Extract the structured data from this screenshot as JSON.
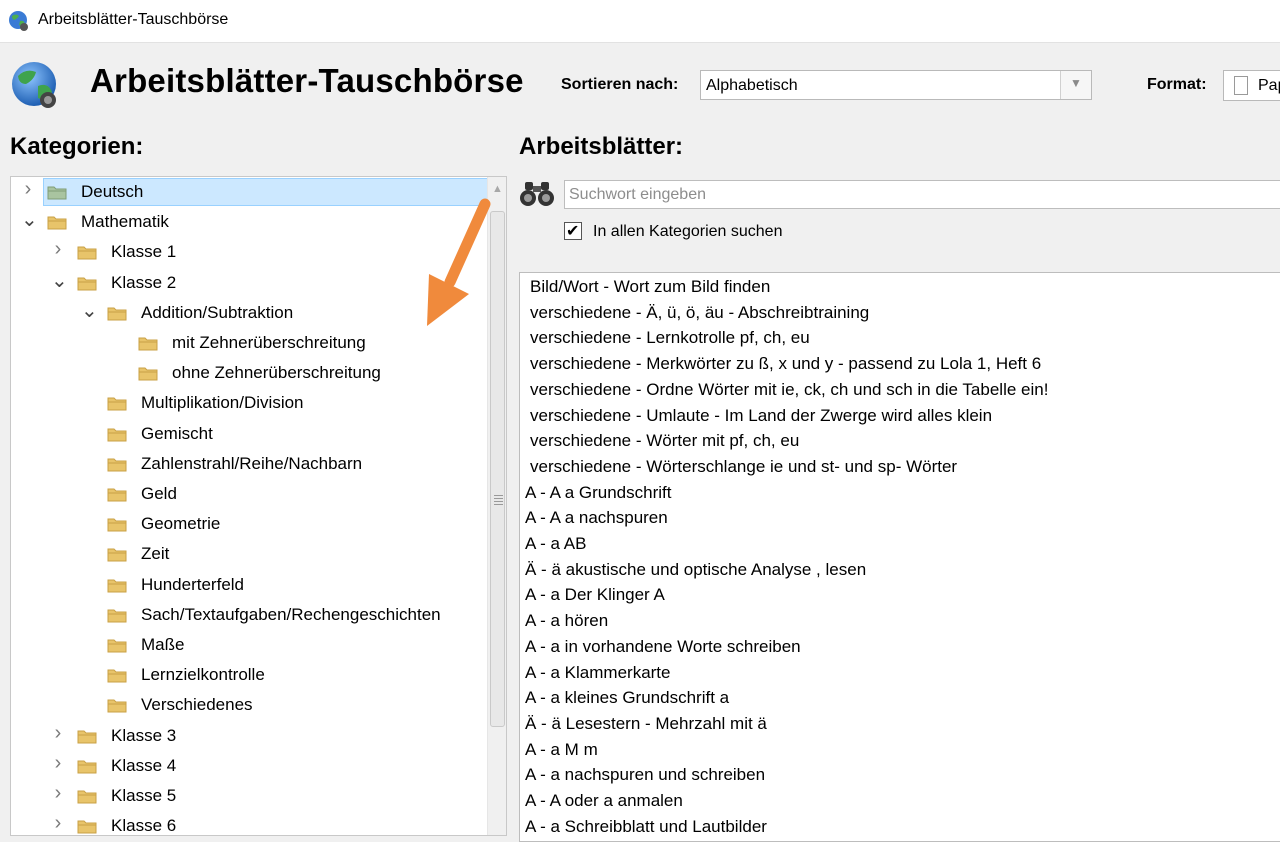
{
  "window": {
    "title": "Arbeitsblätter-Tauschbörse"
  },
  "header": {
    "app_title": "Arbeitsblätter-Tauschbörse",
    "sort_label": "Sortieren nach:",
    "sort_value": "Alphabetisch",
    "format_label": "Format:",
    "format_value": "Papier"
  },
  "categories": {
    "heading": "Kategorien:",
    "tree": [
      {
        "label": "Deutsch",
        "level": 0,
        "expander": "collapsed",
        "selected": true,
        "folder_color": "green"
      },
      {
        "label": "Mathematik",
        "level": 0,
        "expander": "expanded"
      },
      {
        "label": "Klasse 1",
        "level": 1,
        "expander": "collapsed"
      },
      {
        "label": "Klasse 2",
        "level": 1,
        "expander": "expanded"
      },
      {
        "label": "Addition/Subtraktion",
        "level": 2,
        "expander": "expanded"
      },
      {
        "label": "mit Zehnerüberschreitung",
        "level": 3,
        "expander": "none"
      },
      {
        "label": "ohne Zehnerüberschreitung",
        "level": 3,
        "expander": "none"
      },
      {
        "label": "Multiplikation/Division",
        "level": 2,
        "expander": "none"
      },
      {
        "label": "Gemischt",
        "level": 2,
        "expander": "none"
      },
      {
        "label": "Zahlenstrahl/Reihe/Nachbarn",
        "level": 2,
        "expander": "none"
      },
      {
        "label": "Geld",
        "level": 2,
        "expander": "none"
      },
      {
        "label": "Geometrie",
        "level": 2,
        "expander": "none"
      },
      {
        "label": "Zeit",
        "level": 2,
        "expander": "none"
      },
      {
        "label": "Hunderterfeld",
        "level": 2,
        "expander": "none"
      },
      {
        "label": "Sach/Textaufgaben/Rechengeschichten",
        "level": 2,
        "expander": "none"
      },
      {
        "label": "Maße",
        "level": 2,
        "expander": "none"
      },
      {
        "label": "Lernzielkontrolle",
        "level": 2,
        "expander": "none"
      },
      {
        "label": "Verschiedenes",
        "level": 2,
        "expander": "none"
      },
      {
        "label": "Klasse 3",
        "level": 1,
        "expander": "collapsed"
      },
      {
        "label": "Klasse 4",
        "level": 1,
        "expander": "collapsed"
      },
      {
        "label": "Klasse 5",
        "level": 1,
        "expander": "collapsed"
      },
      {
        "label": "Klasse 6",
        "level": 1,
        "expander": "collapsed"
      }
    ]
  },
  "worksheets": {
    "heading": "Arbeitsblätter:",
    "search_placeholder": "Suchwort eingeben",
    "search_value": "",
    "all_categories_label": "In allen Kategorien suchen",
    "all_categories_checked": true,
    "items": [
      "Bild/Wort - Wort zum Bild finden",
      "verschiedene - Ä, ü, ö, äu - Abschreibtraining",
      "verschiedene - Lernkotrolle pf, ch, eu",
      "verschiedene - Merkwörter zu ß, x und y - passend zu Lola 1, Heft 6",
      "verschiedene - Ordne Wörter mit ie, ck, ch und sch in die Tabelle ein!",
      "verschiedene - Umlaute - Im Land der Zwerge wird alles klein",
      "verschiedene - Wörter mit pf, ch, eu",
      "verschiedene - Wörterschlange ie und st- und sp- Wörter",
      "A - A a Grundschrift",
      "A - A a nachspuren",
      "A - a AB",
      "Ä - ä akustische und optische Analyse , lesen",
      "A - a Der Klinger A",
      "A - a hören",
      "A - a in vorhandene Worte schreiben",
      "A - a Klammerkarte",
      "A - a kleines Grundschrift a",
      "Ä - ä Lesestern - Mehrzahl mit ä",
      "A - a M m",
      "A - a nachspuren und schreiben",
      "A - A oder a anmalen",
      "A - a Schreibblatt und Lautbilder"
    ]
  },
  "annotation": {
    "arrow_color": "#f08a3c"
  },
  "colors": {
    "selection_bg": "#cce8ff",
    "selection_border": "#99d1ff",
    "folder": "#e8c46a"
  }
}
